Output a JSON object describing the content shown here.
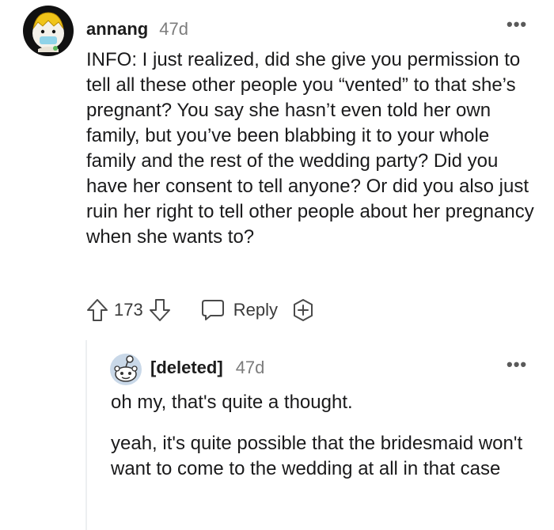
{
  "comment": {
    "username": "annang",
    "time": "47d",
    "more_label": "•••",
    "body": "INFO: I just realized, did she give you permission to tell all these other people you “vented” to that she’s pregnant? You say she hasn’t even told her own family, but you’ve been blabbing it to your whole family and the rest of the wedding party? Did you have her consent to tell anyone? Or did you also just ruin her right to tell other people about her pregnancy when she wants to?",
    "score": "173",
    "reply_label": "Reply"
  },
  "reply": {
    "username": "[deleted]",
    "time": "47d",
    "more_label": "•••",
    "paragraphs": [
      "oh my, that's quite a thought.",
      "yeah, it's quite possible that the bridesmaid won't want to come to the wedding at all in that case"
    ]
  },
  "icons": {
    "upvote": "upvote-arrow-icon",
    "downvote": "downvote-arrow-icon",
    "reply": "speech-bubble-icon",
    "award": "award-plus-icon"
  },
  "colors": {
    "text": "#1a1a1b",
    "meta": "#7c7c7c",
    "thread_line": "#edeff1"
  }
}
